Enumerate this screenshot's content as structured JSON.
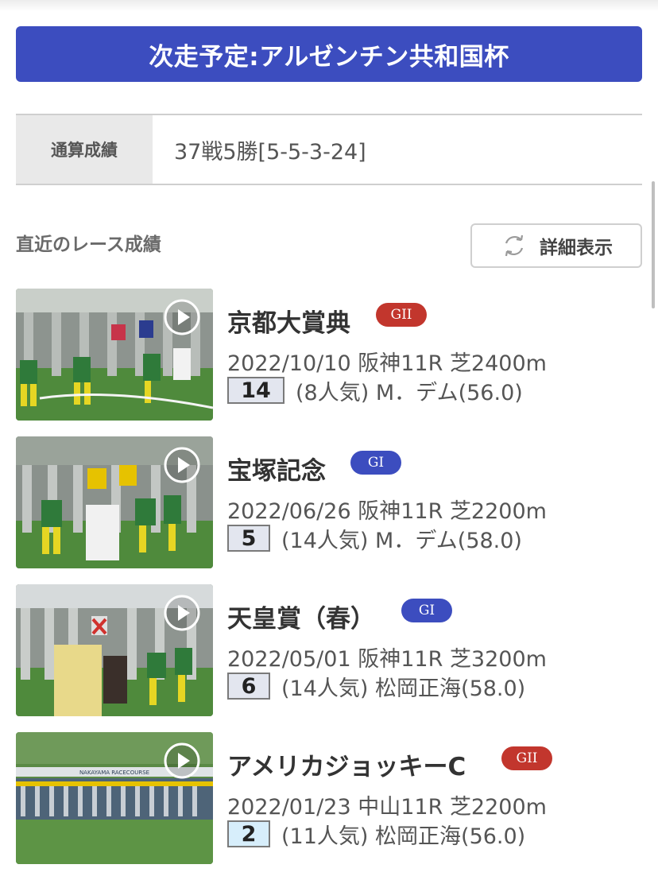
{
  "next_race": {
    "label": "次走予定:アルゼンチン共和国杯"
  },
  "career": {
    "label": "通算成績",
    "value": "37戦5勝[5-5-3-24]"
  },
  "recent": {
    "title": "直近のレース成績",
    "detail_button": "詳細表示",
    "detail_icon": "refresh-icon"
  },
  "races": [
    {
      "name": "京都大賞典",
      "grade": "GII",
      "grade_color": "#c2362d",
      "date": "2022/10/10",
      "venue": "阪神11R",
      "course": "芝2400m",
      "rank": "14",
      "popularity": "(8人気)",
      "jockey": "M．デム(56.0)",
      "thumb_caption": "阪神11R"
    },
    {
      "name": "宝塚記念",
      "grade": "GI",
      "grade_color": "#3c4dbf",
      "date": "2022/06/26",
      "venue": "阪神11R",
      "course": "芝2200m",
      "rank": "5",
      "popularity": "(14人気)",
      "jockey": "M．デム(58.0)",
      "thumb_caption": "宝塚記念"
    },
    {
      "name": "天皇賞（春）",
      "grade": "GI",
      "grade_color": "#3c4dbf",
      "date": "2022/05/01",
      "venue": "阪神11R",
      "course": "芝3200m",
      "rank": "6",
      "popularity": "(14人気)",
      "jockey": "松岡正海(58.0)",
      "thumb_caption": "天皇賞(春)"
    },
    {
      "name": "アメリカジョッキーC",
      "grade": "GII",
      "grade_color": "#c2362d",
      "date": "2022/01/23",
      "venue": "中山11R",
      "course": "芝2200m",
      "rank": "2",
      "popularity": "(11人気)",
      "jockey": "松岡正海(56.0)",
      "thumb_caption": "中山11R",
      "thumb_banner": "NAKAYAMA RACECOURSE"
    }
  ]
}
